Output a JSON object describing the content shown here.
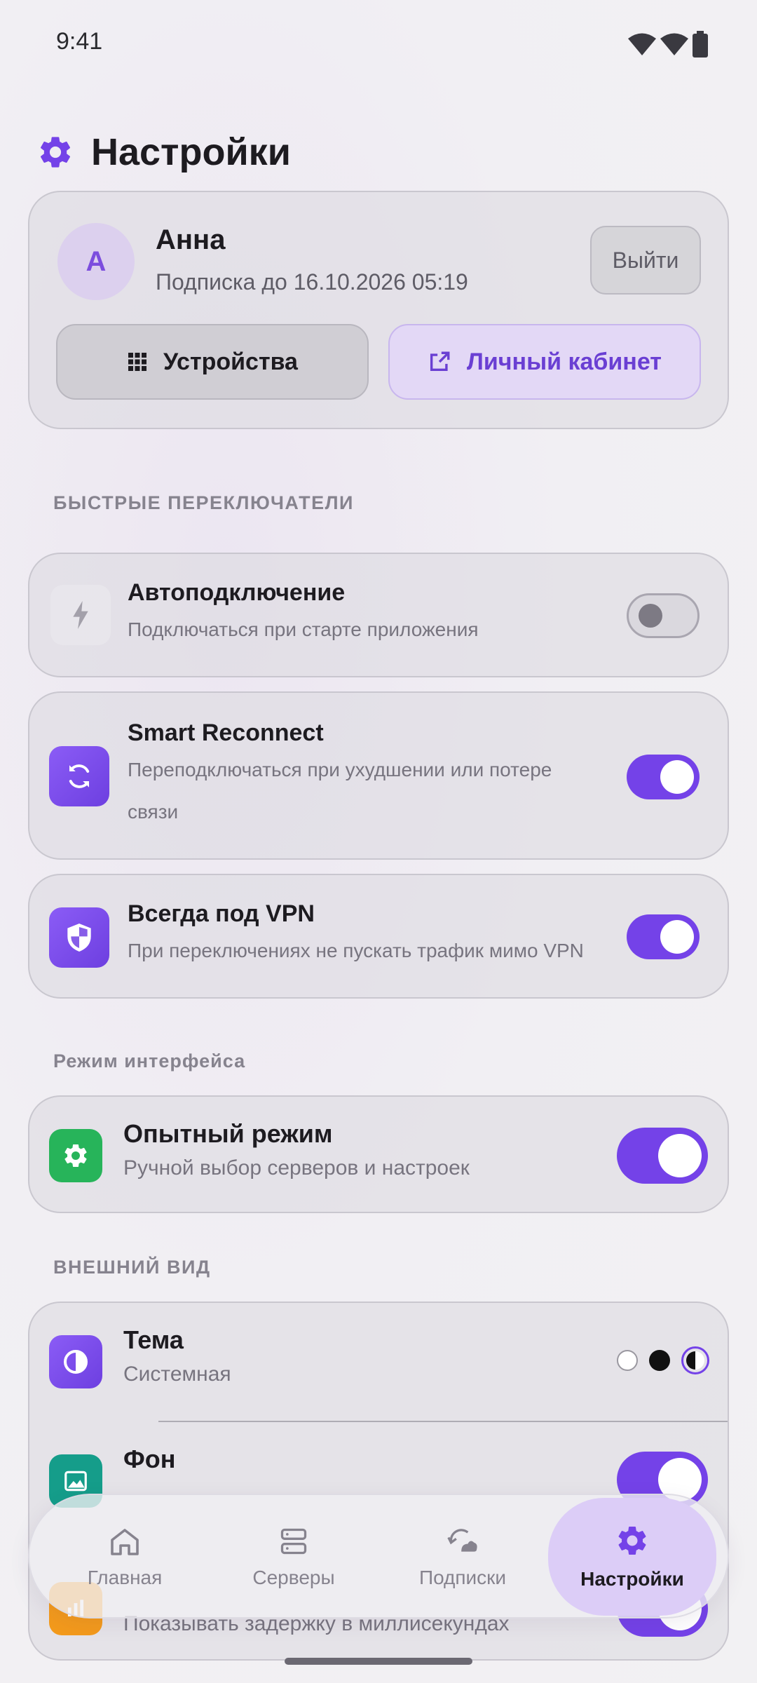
{
  "status_bar": {
    "time": "9:41",
    "icons": [
      "wifi-icon",
      "signal-icon",
      "battery-icon"
    ]
  },
  "header": {
    "title": "Настройки",
    "icon": "gear-icon"
  },
  "account": {
    "avatar_letter": "А",
    "name": "Анна",
    "subscription": "Подписка до 16.10.2026 05:19",
    "logout_label": "Выйти",
    "devices_label": "Устройства",
    "cabinet_label": "Личный кабинет"
  },
  "sections": {
    "quick": "БЫСТРЫЕ ПЕРЕКЛЮЧАТЕЛИ",
    "mode": "Режим интерфейса",
    "appearance": "ВНЕШНИЙ ВИД"
  },
  "toggles": {
    "autoconnect": {
      "title": "Автоподключение",
      "subtitle": "Подключаться при старте приложения",
      "on": false
    },
    "smart": {
      "title": "Smart Reconnect",
      "subtitle_line1": "Переподключаться при ухудшении или потере",
      "subtitle_line2": "связи",
      "on": true
    },
    "always_vpn": {
      "title": "Всегда под VPN",
      "subtitle": "При переключениях не пускать трафик мимо VPN",
      "on": true
    },
    "expert": {
      "title": "Опытный режим",
      "subtitle": "Ручной выбор серверов и настроек",
      "on": true
    }
  },
  "appearance": {
    "theme": {
      "title": "Тема",
      "value": "Системная",
      "options": [
        "light",
        "dark",
        "system"
      ],
      "selected": "system"
    },
    "background": {
      "title": "Фон",
      "on": true
    },
    "ping": {
      "subtitle": "Показывать задержку в миллисекундах",
      "on": true
    }
  },
  "nav": {
    "items": [
      {
        "label": "Главная",
        "icon": "home-icon"
      },
      {
        "label": "Серверы",
        "icon": "servers-icon"
      },
      {
        "label": "Подписки",
        "icon": "subscriptions-icon"
      },
      {
        "label": "Настройки",
        "icon": "gear-icon"
      }
    ],
    "active": "Настройки"
  },
  "colors": {
    "accent": "#7442e8",
    "green": "#27b45a",
    "teal": "#159d8a",
    "orange": "#f39a1c"
  }
}
